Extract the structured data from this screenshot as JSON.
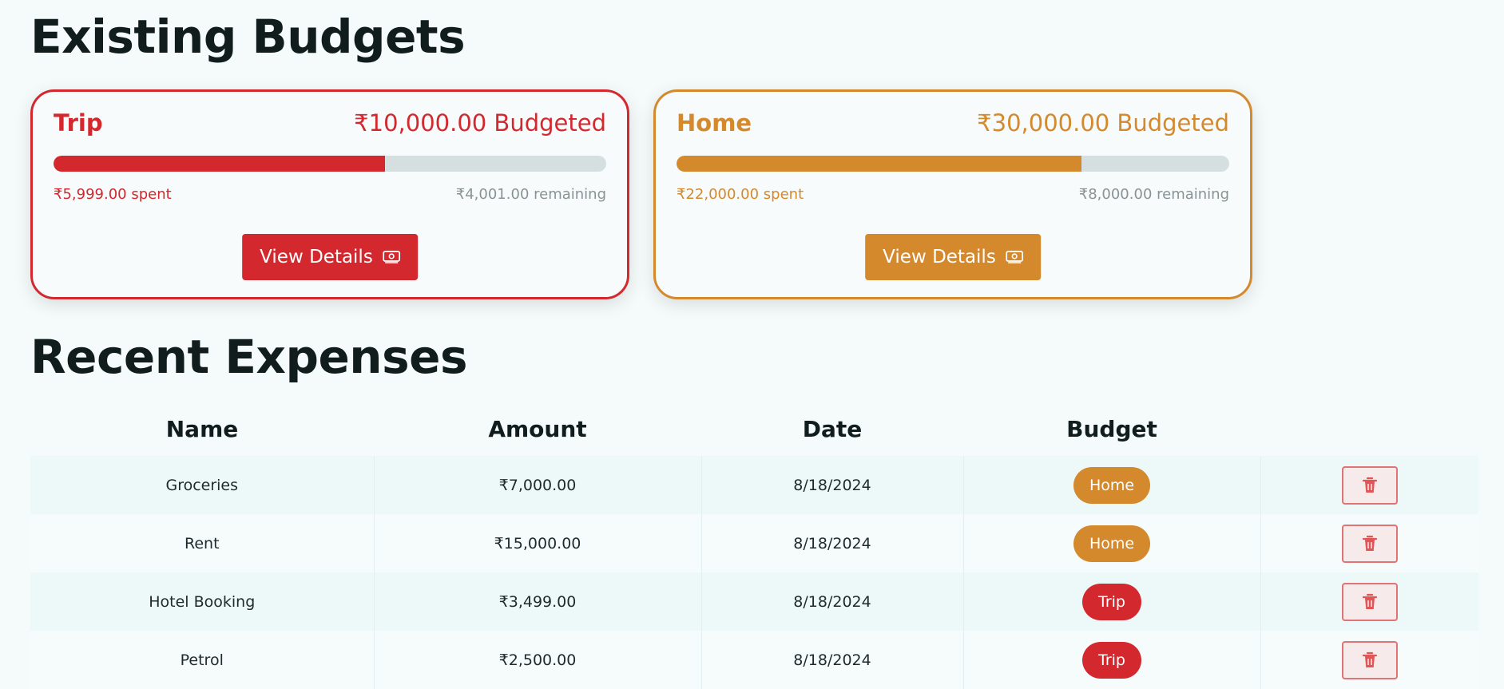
{
  "colors": {
    "trip": "#d3282e",
    "home": "#d4892d"
  },
  "budgets_section": {
    "title": "Existing Budgets",
    "cards": [
      {
        "name": "Trip",
        "budgeted": "₹10,000.00 Budgeted",
        "spent": "₹5,999.00 spent",
        "remaining": "₹4,001.00 remaining",
        "progress": 0.5999,
        "button_label": "View Details",
        "button_icon": "cash-icon",
        "color": "#d3282e"
      },
      {
        "name": "Home",
        "budgeted": "₹30,000.00 Budgeted",
        "spent": "₹22,000.00 spent",
        "remaining": "₹8,000.00 remaining",
        "progress": 0.7333,
        "button_label": "View Details",
        "button_icon": "cash-icon",
        "color": "#d4892d"
      }
    ]
  },
  "expenses_section": {
    "title": "Recent Expenses",
    "columns": [
      "Name",
      "Amount",
      "Date",
      "Budget",
      ""
    ],
    "rows": [
      {
        "name": "Groceries",
        "amount": "₹7,000.00",
        "date": "8/18/2024",
        "budget": "Home",
        "budget_color": "#d4892d",
        "action_icon": "trash-icon"
      },
      {
        "name": "Rent",
        "amount": "₹15,000.00",
        "date": "8/18/2024",
        "budget": "Home",
        "budget_color": "#d4892d",
        "action_icon": "trash-icon"
      },
      {
        "name": "Hotel Booking",
        "amount": "₹3,499.00",
        "date": "8/18/2024",
        "budget": "Trip",
        "budget_color": "#d3282e",
        "action_icon": "trash-icon"
      },
      {
        "name": "Petrol",
        "amount": "₹2,500.00",
        "date": "8/18/2024",
        "budget": "Trip",
        "budget_color": "#d3282e",
        "action_icon": "trash-icon"
      }
    ]
  }
}
